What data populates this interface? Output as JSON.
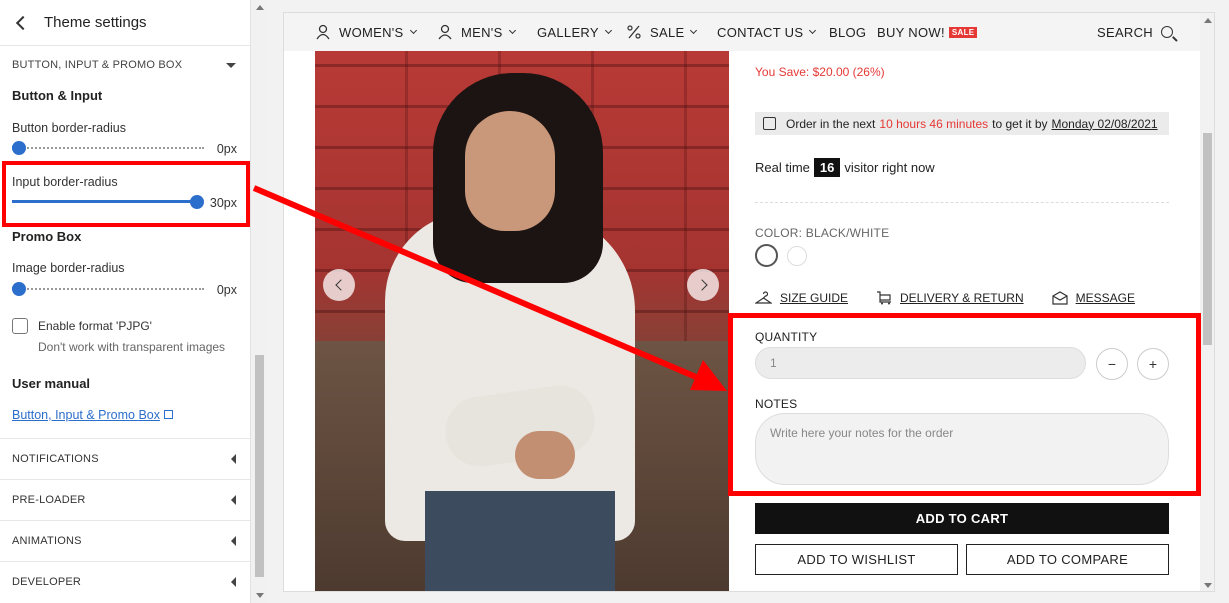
{
  "panel": {
    "title": "Theme settings",
    "section": "BUTTON, INPUT & PROMO BOX",
    "button_input_title": "Button & Input",
    "button_radius": {
      "label": "Button border-radius",
      "value": "0px",
      "level": 0
    },
    "input_radius": {
      "label": "Input border-radius",
      "value": "30px",
      "level": 1
    },
    "promo_title": "Promo Box",
    "image_radius": {
      "label": "Image border-radius",
      "value": "0px",
      "level": 0
    },
    "pjpg": {
      "label": "Enable format 'PJPG'",
      "help": "Don't work with transparent images",
      "checked": false
    },
    "manual_title": "User manual",
    "manual_link": "Button, Input & Promo Box",
    "collapsed": [
      "NOTIFICATIONS",
      "PRE-LOADER",
      "ANIMATIONS",
      "DEVELOPER"
    ]
  },
  "nav": {
    "items": [
      "WOMEN'S",
      "MEN'S",
      "GALLERY",
      "SALE",
      "CONTACT US",
      "BLOG",
      "BUY NOW!"
    ],
    "sale_badge": "SALE",
    "search": "SEARCH"
  },
  "product": {
    "you_save": "You Save: $20.00 (26%)",
    "order_prefix": "Order in the next",
    "order_time": "10 hours 46 minutes",
    "order_mid": "to get it by",
    "order_date": "Monday 02/08/2021",
    "visitors_prefix": "Real time",
    "visitors_count": "16",
    "visitors_suffix": "visitor right now",
    "color_label": "COLOR: BLACK/WHITE",
    "links": [
      "SIZE GUIDE",
      "DELIVERY & RETURN",
      "MESSAGE"
    ],
    "quantity_label": "QUANTITY",
    "quantity_value": "1",
    "minus": "−",
    "plus": "+",
    "notes_label": "NOTES",
    "notes_placeholder": "Write here your notes for the order",
    "add_to_cart": "ADD TO CART",
    "add_to_wishlist": "ADD TO WISHLIST",
    "add_to_compare": "ADD TO COMPARE"
  },
  "colors": {
    "accent": "#2c6ecb",
    "highlight": "#ff0000",
    "sale": "#e53935"
  }
}
